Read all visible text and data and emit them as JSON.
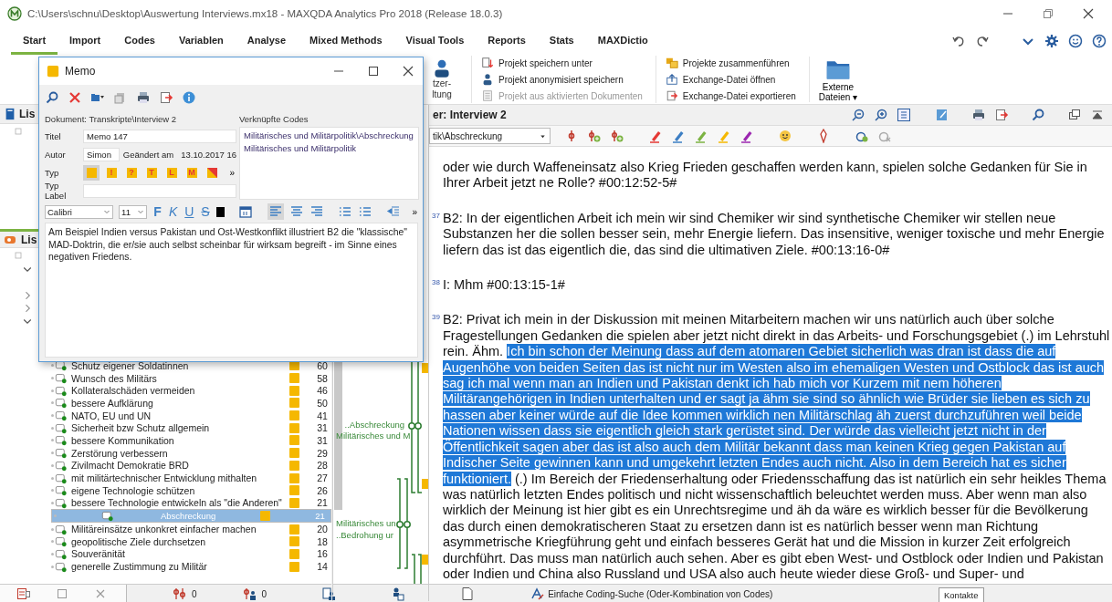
{
  "window": {
    "title": "C:\\Users\\schnu\\Desktop\\Auswertung Interviews.mx18 - MAXQDA Analytics Pro 2018  (Release 18.0.3)"
  },
  "menu_tabs": [
    {
      "label": "Start",
      "selected": true
    },
    {
      "label": "Import",
      "selected": false
    },
    {
      "label": "Codes",
      "selected": false
    },
    {
      "label": "Variablen",
      "selected": false
    },
    {
      "label": "Analyse",
      "selected": false
    },
    {
      "label": "Mixed Methods",
      "selected": false
    },
    {
      "label": "Visual Tools",
      "selected": false
    },
    {
      "label": "Reports",
      "selected": false
    },
    {
      "label": "Stats",
      "selected": false
    },
    {
      "label": "MAXDictio",
      "selected": false
    }
  ],
  "ribbon": {
    "partial_button": [
      "tzer-",
      "ltung"
    ],
    "groups": [
      [
        {
          "label": "Projekt speichern unter",
          "disabled": false
        },
        {
          "label": "Projekt anonymisiert speichern",
          "disabled": false
        },
        {
          "label": "Projekt aus aktivierten Dokumenten",
          "disabled": true
        }
      ],
      [
        {
          "label": "Projekte zusammenführen",
          "disabled": false
        },
        {
          "label": "Exchange-Datei öffnen",
          "disabled": false
        },
        {
          "label": "Exchange-Datei exportieren",
          "disabled": false
        }
      ]
    ],
    "external": [
      "Externe",
      "Dateien",
      "▾"
    ]
  },
  "document_list": {
    "header": "Lis"
  },
  "code_system": {
    "header": "Lis",
    "rows": [
      {
        "name": "Schutz eigener Soldatinnen",
        "count": "60",
        "selected": false
      },
      {
        "name": "Wunsch des Militärs",
        "count": "58",
        "selected": false
      },
      {
        "name": "Kollateralschäden vermeiden",
        "count": "46",
        "selected": false
      },
      {
        "name": "bessere Aufklärung",
        "count": "50",
        "selected": false
      },
      {
        "name": "NATO, EU und UN",
        "count": "41",
        "selected": false
      },
      {
        "name": "Sicherheit bzw Schutz allgemein",
        "count": "31",
        "selected": false
      },
      {
        "name": "bessere Kommunikation",
        "count": "31",
        "selected": false
      },
      {
        "name": "Zerstörung verbessern",
        "count": "29",
        "selected": false
      },
      {
        "name": "Zivilmacht Demokratie BRD",
        "count": "28",
        "selected": false
      },
      {
        "name": "mit militärtechnischer Entwicklung mithalten",
        "count": "27",
        "selected": false
      },
      {
        "name": "eigene Technologie schützen",
        "count": "26",
        "selected": false
      },
      {
        "name": "bessere Technologie entwickeln als \"die Anderen\"",
        "count": "21",
        "selected": false
      },
      {
        "name": "Abschreckung",
        "count": "21",
        "selected": true
      },
      {
        "name": "Militäreinsätze unkonkret einfacher machen",
        "count": "20",
        "selected": false
      },
      {
        "name": "geopolitische Ziele durchsetzen",
        "count": "18",
        "selected": false
      },
      {
        "name": "Souveränität",
        "count": "16",
        "selected": false
      },
      {
        "name": "generelle Zustimmung zu Militär",
        "count": "14",
        "selected": false
      }
    ]
  },
  "coding_stripes": {
    "labels": [
      "..Abschreckung",
      "Militärisches und M",
      "Militärisches un",
      "..Bedrohung ur"
    ]
  },
  "document_browser": {
    "header": "er: Interview 2",
    "code_dropdown": "tik\\Abschreckung",
    "paragraphs": [
      {
        "segments": [
          {
            "text": "oder wie durch Waffeneinsatz also Krieg Frieden geschaffen werden kann, spielen solche Gedanken für Sie in Ihrer Arbeit jetzt ne Rolle?  #00:12:52-5#",
            "highlighted": false
          }
        ]
      },
      {
        "number": "37",
        "segments": [
          {
            "text": "B2:  In der eigentlichen Arbeit ich mein wir sind Chemiker wir sind synthetische Chemiker wir stellen neue Substanzen her die sollen besser sein, mehr Energie liefern. Das insensitive, weniger toxische und mehr Energie liefern das ist das eigentlich die, das sind die ultimativen Ziele.  #00:13:16-0#",
            "highlighted": false
          }
        ]
      },
      {
        "number": "38",
        "segments": [
          {
            "text": "I: Mhm  #00:13:15-1#",
            "highlighted": false
          }
        ]
      },
      {
        "number": "39",
        "segments": [
          {
            "text": "B2: Privat ich mein in der Diskussion mit meinen Mitarbeitern machen wir uns natürlich auch über solche Fragestellungen Gedanken die spielen aber jetzt nicht direkt in das Arbeits- und Forschungsgebiet (.) im Lehrstuhl rein. Ähm. ",
            "highlighted": false
          },
          {
            "text": "Ich bin schon der Meinung dass auf dem atomaren Gebiet sicherlich was dran ist dass die auf Augenhöhe von beiden Seiten das ist nicht nur im Westen also im ehemaligen Westen und Ostblock das ist auch sag ich mal wenn man an Indien und Pakistan denkt ich hab mich vor Kurzem mit nem höheren Militärangehörigen in Indien unterhalten und er sagt ja ähm sie sind so ähnlich wie Brüder sie lieben es sich zu hassen aber keiner würde auf die Idee kommen wirklich nen Militärschlag äh zuerst durchzuführen weil beide Nationen wissen dass sie eigentlich gleich stark gerüstet sind. Der würde das vielleicht jetzt nicht in der Öffentlichkeit sagen aber das ist also auch dem Militär bekannt dass man keinen Krieg gegen Pakistan auf Indischer Seite gewinnen kann und umgekehrt letzten Endes auch nicht. Also in dem Bereich hat es sicher funktioniert.",
            "highlighted": true
          },
          {
            "text": " (.) Im Bereich der Friedenserhaltung oder Friedensschaffung das ist natürlich ein sehr heikles Thema was natürlich letzten Endes politisch und nicht wissenschaftlich beleuchtet werden muss. Aber wenn man also wirklich der Meinung ist hier gibt es ein Unrechtsregime und äh da wäre es wirklich besser für die Bevölkerung das durch einen demokratischeren Staat zu ersetzen dann ist es natürlich besser wenn man Richtung asymmetrische Kriegführung geht und einfach besseres Gerät hat und die Mission in kurzer Zeit erfolgreich durchführt. Das muss man natürlich auch sehen. Aber es gibt eben West- und Ostblock oder Indien und Pakistan oder Indien und China also Russland und USA also auch heute wieder diese Groß- und Super- und",
            "highlighted": false
          }
        ]
      }
    ]
  },
  "memo": {
    "title": "Memo",
    "document": "Dokument: Transkripte\\Interview 2",
    "linked_codes_label": "Verknüpfte Codes",
    "title_field": {
      "label": "Titel",
      "value": "Memo 147"
    },
    "author_field": {
      "label": "Autor",
      "value": "Simon"
    },
    "changed": {
      "label": "Geändert am",
      "value": "13.10.2017 16"
    },
    "type": {
      "label": "Typ",
      "more": "»",
      "options": [
        {
          "kind": "plain",
          "selected": true
        },
        {
          "kind": "letter",
          "symbol": "!",
          "selected": false
        },
        {
          "kind": "letter",
          "symbol": "?",
          "selected": false
        },
        {
          "kind": "letter",
          "symbol": "T",
          "selected": false
        },
        {
          "kind": "letter",
          "symbol": "L",
          "selected": false
        },
        {
          "kind": "letter",
          "symbol": "M",
          "selected": false
        },
        {
          "kind": "diagonal",
          "selected": false
        }
      ]
    },
    "type_label": {
      "label": "Typ Label"
    },
    "linked_codes": [
      "Militärisches und Militärpolitik\\Abschreckung",
      "Militärisches und Militärpolitik"
    ],
    "format_bar": {
      "font": "Calibri",
      "size": "11",
      "styles": [
        "F",
        "K",
        "U",
        "S"
      ],
      "more": "»"
    },
    "text": "Am Beispiel Indien versus Pakistan und Ost-Westkonflikt illustriert B2 die \"klassische\" MAD-Doktrin, die er/sie auch selbst scheinbar für wirksam begreift - im Sinne eines negativen Friedens."
  },
  "status_bar": {
    "counts": [
      "0",
      "0"
    ],
    "search_mode": "Einfache Coding-Suche (Oder-Kombination von Codes)",
    "tooltip": "Kontakte"
  }
}
